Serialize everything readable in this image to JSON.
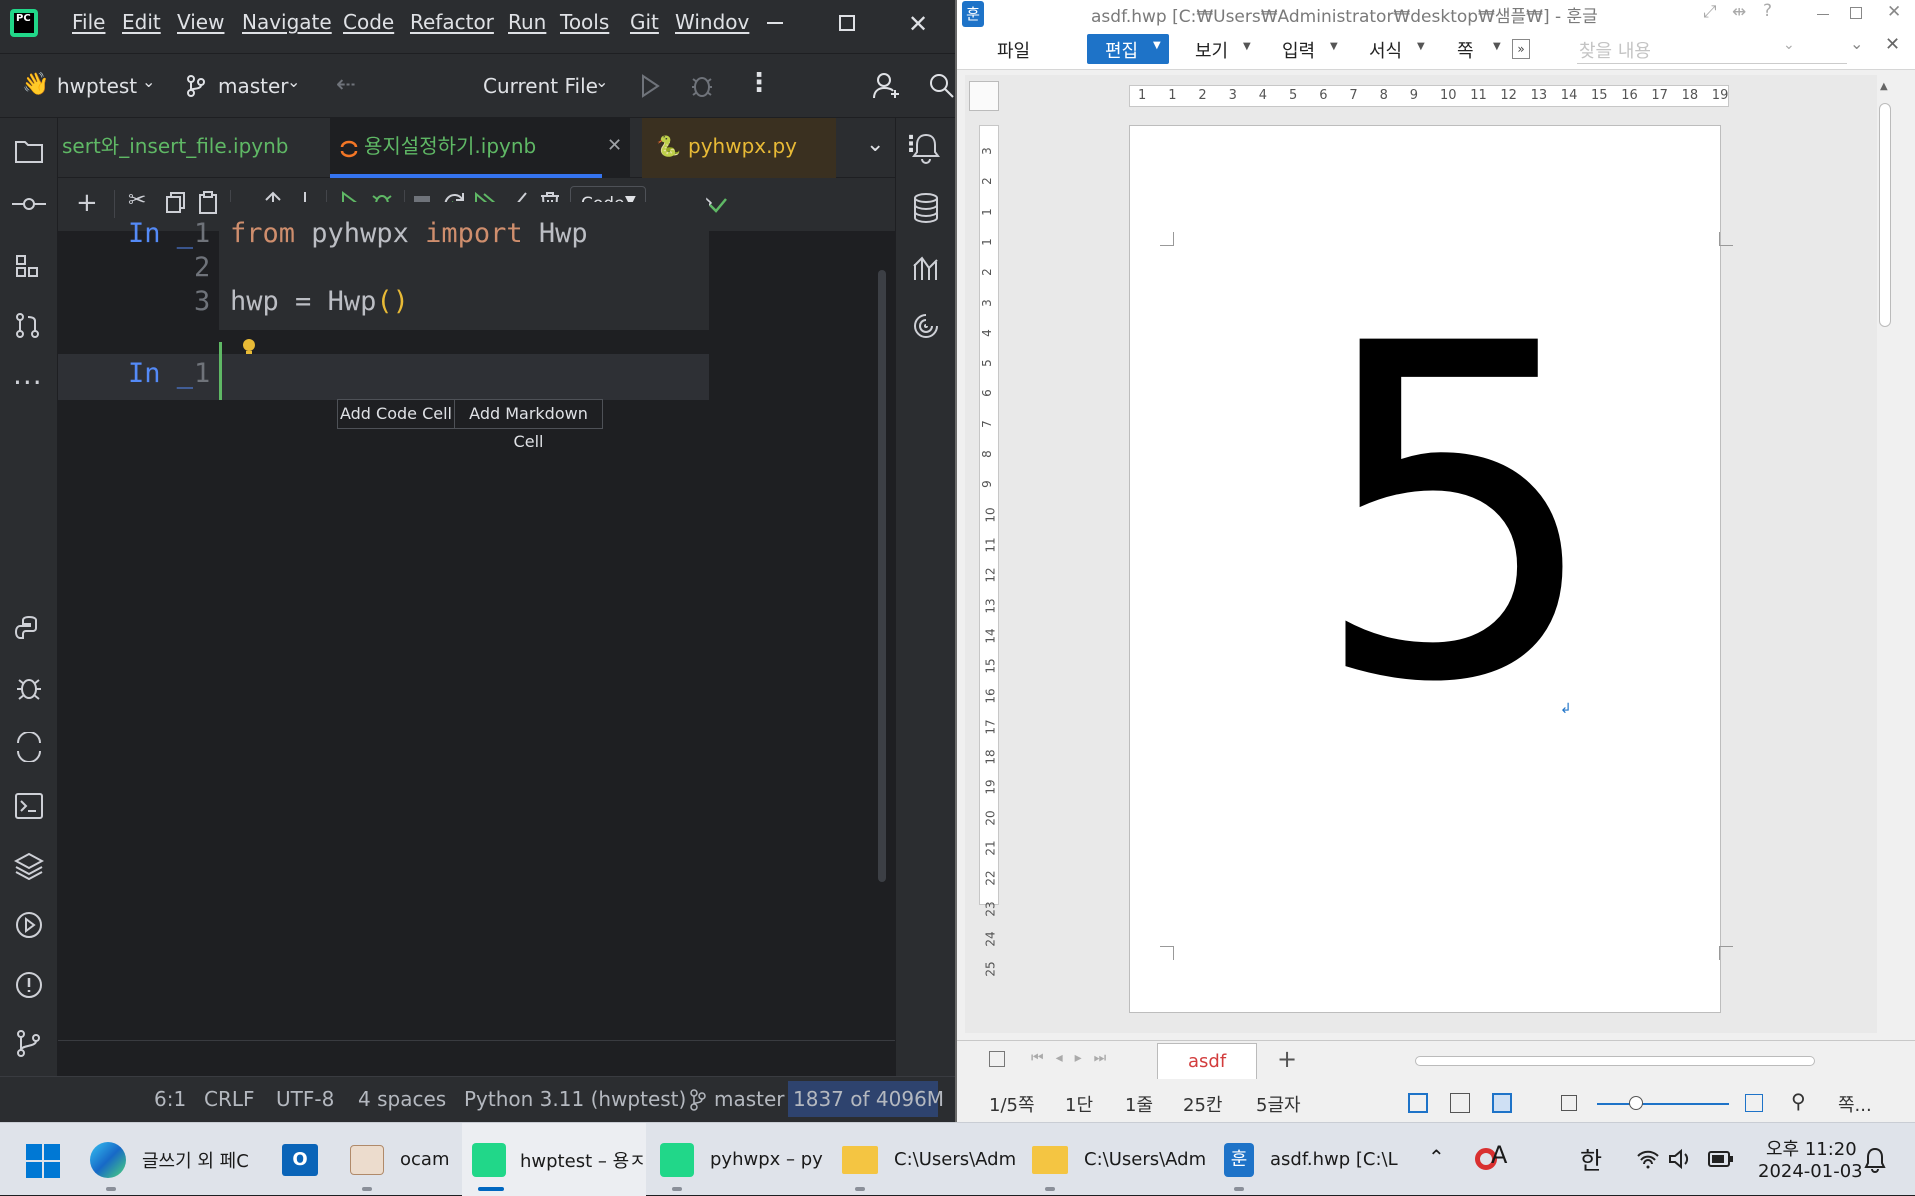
{
  "pycharm": {
    "menu": [
      "File",
      "Edit",
      "View",
      "Navigate",
      "Code",
      "Refactor",
      "Run",
      "Tools",
      "Git",
      "Windov"
    ],
    "project": "hwptest",
    "branch": "master",
    "run_config": "Current File",
    "tabs": [
      "sert와_insert_file.ipynb",
      "용지설정하기.ipynb",
      "pyhwpx.py"
    ],
    "cell_type": "Code",
    "cell1": {
      "prompt": "In _",
      "line_numbers": [
        "1",
        "2",
        "3"
      ],
      "line1": {
        "kw1": "from",
        "mod": "pyhwpx",
        "kw2": "import",
        "name": "Hwp"
      },
      "line3": {
        "var": "hwp",
        "op": "=",
        "call": "Hwp",
        "paren": "()"
      }
    },
    "cell2": {
      "prompt": "In _",
      "line_number": "1"
    },
    "add_code_cell": "Add Code Cell",
    "add_markdown_cell": "Add Markdown Cell",
    "status": {
      "position": "6:1",
      "line_sep": "CRLF",
      "encoding": "UTF-8",
      "indent": "4 spaces",
      "interpreter": "Python 3.11 (hwptest)",
      "branch": "master",
      "memory": "1837 of 4096M"
    }
  },
  "hwp": {
    "title": "asdf.hwp [C:₩Users₩Administrator₩desktop₩샘플₩] - 훈글",
    "menu": [
      "파일",
      "편집",
      "보기",
      "입력",
      "서식",
      "쪽"
    ],
    "search_placeholder": "찾을 내용",
    "ruler_h": [
      "1",
      "1",
      "2",
      "3",
      "4",
      "5",
      "6",
      "7",
      "8",
      "9",
      "10",
      "11",
      "12",
      "13",
      "14",
      "15",
      "16",
      "17",
      "18",
      "19"
    ],
    "ruler_v": [
      "3",
      "2",
      "1",
      "1",
      "2",
      "3",
      "4",
      "5",
      "6",
      "7",
      "8",
      "9",
      "10",
      "11",
      "12",
      "13",
      "14",
      "15",
      "16",
      "17",
      "18",
      "19",
      "20",
      "21",
      "22",
      "23",
      "24",
      "25"
    ],
    "page_text": "5",
    "sheet_tab": "asdf",
    "status": {
      "page": "1/5쪽",
      "section": "1단",
      "line": "1줄",
      "col": "25칸",
      "chars": "5글자",
      "zoom": "쪽..."
    }
  },
  "taskbar": {
    "items": [
      "글쓰기 외 페C",
      "ocam",
      "hwptest – 용ㅈ",
      "pyhwpx – py",
      "C:\\Users\\Adm",
      "C:\\Users\\Adm",
      "asdf.hwp [C:\\L"
    ],
    "ime1": "A",
    "ime2": "한",
    "time": "오후 11:20",
    "date": "2024-01-03"
  },
  "colors": {
    "accent": "#3574f0",
    "keyword": "#cf8e6d",
    "paren": "#e8ba36",
    "cell_green": "#5fb865",
    "hwp_blue": "#1e73c8",
    "tab_red": "#d23c3c"
  }
}
